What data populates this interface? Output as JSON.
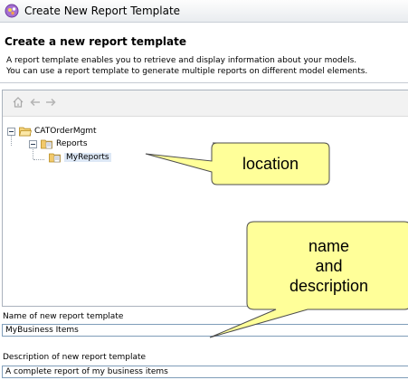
{
  "window": {
    "title": "Create New Report Template"
  },
  "header": {
    "title": "Create a new report template",
    "description_line1": "A report template enables you to retrieve and display information about your models.",
    "description_line2": "You can use a report template to generate multiple reports on different model elements."
  },
  "toolbar": {
    "icons": [
      "home-icon",
      "back-arrow-icon",
      "forward-arrow-icon"
    ]
  },
  "tree": {
    "items": [
      {
        "label": "CATOrderMgmt",
        "icon": "open-folder-icon",
        "expanded": true
      },
      {
        "label": "Reports",
        "icon": "report-folder-icon",
        "expanded": true
      },
      {
        "label": "MyReports",
        "icon": "report-folder-icon",
        "selected": true
      }
    ]
  },
  "name_field": {
    "label": "Name of new report template",
    "value": "MyBusiness Items"
  },
  "description_field": {
    "label": "Description of new report template",
    "value": "A complete report of my business items"
  },
  "callouts": {
    "location": "location",
    "name_line1": "name",
    "name_line2": "and",
    "name_line3": "description"
  },
  "colors": {
    "callout_fill": "#ffff99",
    "selection": "#dde8f6",
    "accent": "#7f9db9"
  }
}
